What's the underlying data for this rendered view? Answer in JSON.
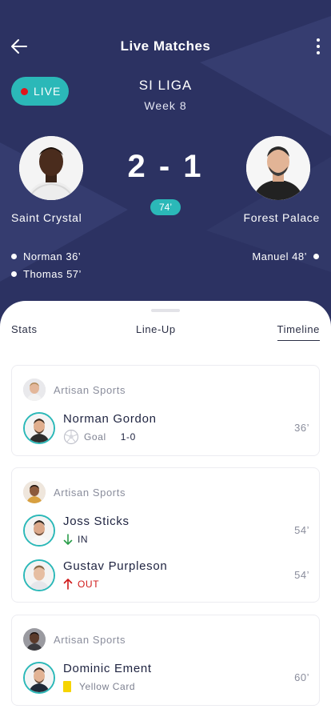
{
  "header": {
    "title": "Live Matches",
    "back_icon": "arrow-left-icon",
    "more_icon": "more-vertical-icon"
  },
  "live_badge": {
    "label": "LIVE",
    "dot_color": "#e0161c"
  },
  "match": {
    "league": "SI LIGA",
    "week": "Week 8",
    "score": "2 - 1",
    "minute": "74’",
    "home": {
      "name": "Saint Crystal",
      "scorers": [
        "Norman 36’",
        "Thomas 57’"
      ]
    },
    "away": {
      "name": "Forest Palace",
      "scorers": [
        "Manuel 48’"
      ]
    }
  },
  "tabs": [
    {
      "label": "Stats"
    },
    {
      "label": "Line-Up"
    },
    {
      "label": "Timeline",
      "active": true
    }
  ],
  "timeline": [
    {
      "team_label": "Artisan Sports",
      "events": [
        {
          "player": "Norman Gordon",
          "type": "Goal",
          "detail": "Goal",
          "score": "1-0",
          "time": "36’"
        }
      ]
    },
    {
      "team_label": "Artisan Sports",
      "events": [
        {
          "player": "Joss Sticks",
          "type": "Sub In",
          "detail": "IN",
          "time": "54’"
        },
        {
          "player": "Gustav Purpleson",
          "type": "Sub Out",
          "detail": "OUT",
          "time": "54’"
        }
      ]
    },
    {
      "team_label": "Artisan Sports",
      "events": [
        {
          "player": "Dominic Ement",
          "type": "Yellow Card",
          "detail": "Yellow Card",
          "time": "60’"
        }
      ]
    }
  ],
  "colors": {
    "hero_bg": "#2c3262",
    "accent": "#2bb8b8",
    "out": "#d01818",
    "yellow_card": "#f6d400"
  }
}
